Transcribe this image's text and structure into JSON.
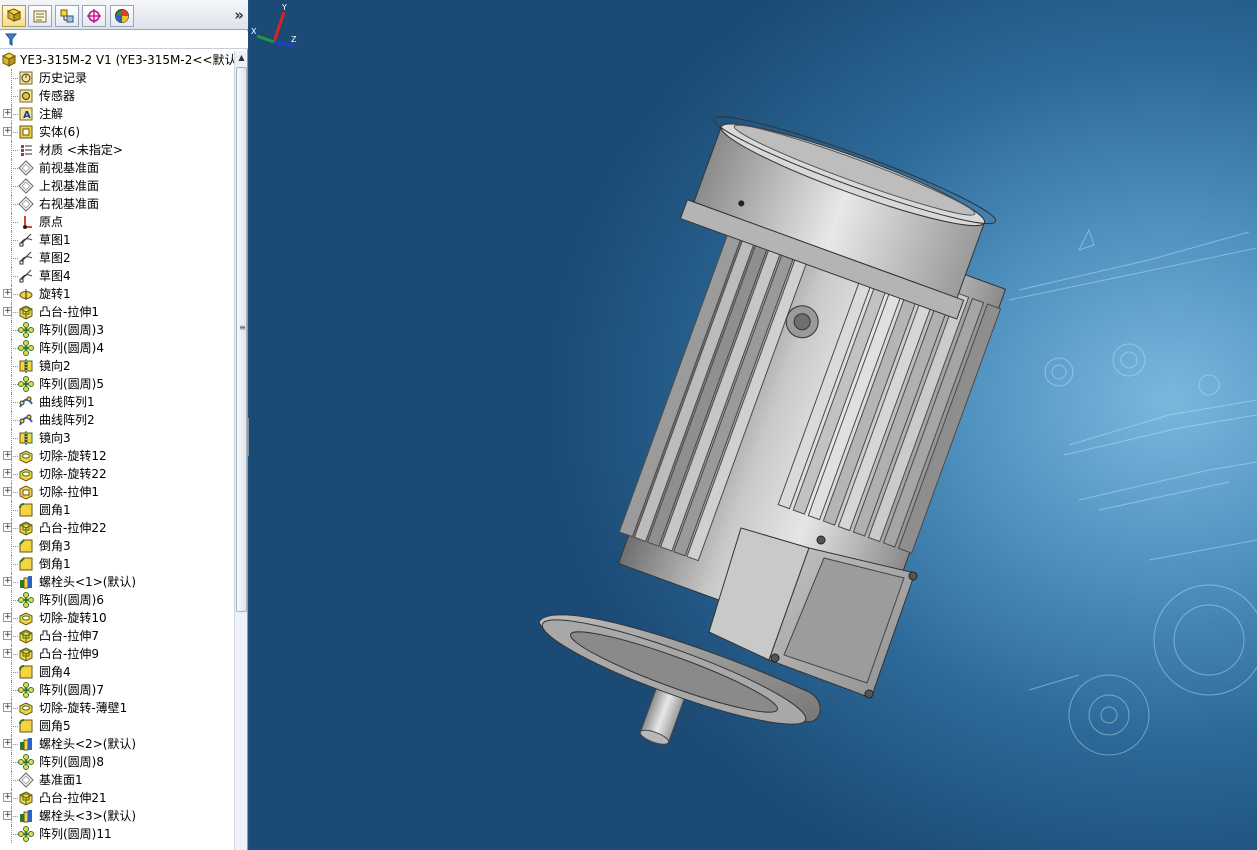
{
  "panel": {
    "tabs": [
      {
        "name": "featuremanager",
        "icon": "feature-tree-icon"
      },
      {
        "name": "propertymanager",
        "icon": "property-manager-icon"
      },
      {
        "name": "configurationmanager",
        "icon": "configuration-manager-icon"
      },
      {
        "name": "dimxpert",
        "icon": "dimxpert-icon"
      },
      {
        "name": "display",
        "icon": "display-manager-icon"
      }
    ],
    "more": "»",
    "scroll_up": "▲",
    "scroll_grip": "≡",
    "collapse": "◂◂◂"
  },
  "tree": {
    "root": "YE3-315M-2 V1  (YE3-315M-2<<默认",
    "items": [
      {
        "label": "历史记录",
        "icon": "history",
        "exp": false
      },
      {
        "label": "传感器",
        "icon": "sensor",
        "exp": false
      },
      {
        "label": "注解",
        "icon": "annotation",
        "exp": true
      },
      {
        "label": "实体(6)",
        "icon": "solid-bodies",
        "exp": true
      },
      {
        "label": "材质 <未指定>",
        "icon": "material",
        "exp": false
      },
      {
        "label": "前视基准面",
        "icon": "plane",
        "exp": false
      },
      {
        "label": "上视基准面",
        "icon": "plane",
        "exp": false
      },
      {
        "label": "右视基准面",
        "icon": "plane",
        "exp": false
      },
      {
        "label": "原点",
        "icon": "origin",
        "exp": false
      },
      {
        "label": "草图1",
        "icon": "sketch",
        "exp": false
      },
      {
        "label": "草图2",
        "icon": "sketch",
        "exp": false
      },
      {
        "label": "草图4",
        "icon": "sketch",
        "exp": false
      },
      {
        "label": "旋转1",
        "icon": "revolve",
        "exp": true
      },
      {
        "label": "凸台-拉伸1",
        "icon": "boss-extrude",
        "exp": true
      },
      {
        "label": "阵列(圆周)3",
        "icon": "circular-pattern",
        "exp": false
      },
      {
        "label": "阵列(圆周)4",
        "icon": "circular-pattern",
        "exp": false
      },
      {
        "label": "镜向2",
        "icon": "mirror",
        "exp": false
      },
      {
        "label": "阵列(圆周)5",
        "icon": "circular-pattern",
        "exp": false
      },
      {
        "label": "曲线阵列1",
        "icon": "curve-pattern",
        "exp": false
      },
      {
        "label": "曲线阵列2",
        "icon": "curve-pattern",
        "exp": false
      },
      {
        "label": "镜向3",
        "icon": "mirror",
        "exp": false
      },
      {
        "label": "切除-旋转12",
        "icon": "cut-revolve",
        "exp": true
      },
      {
        "label": "切除-旋转22",
        "icon": "cut-revolve",
        "exp": true
      },
      {
        "label": "切除-拉伸1",
        "icon": "cut-extrude",
        "exp": true
      },
      {
        "label": "圆角1",
        "icon": "fillet",
        "exp": false
      },
      {
        "label": "凸台-拉伸22",
        "icon": "boss-extrude",
        "exp": true
      },
      {
        "label": "倒角3",
        "icon": "chamfer",
        "exp": false
      },
      {
        "label": "倒角1",
        "icon": "chamfer",
        "exp": false
      },
      {
        "label": "螺栓头<1>(默认)",
        "icon": "library-feature",
        "exp": true
      },
      {
        "label": "阵列(圆周)6",
        "icon": "circular-pattern",
        "exp": false
      },
      {
        "label": "切除-旋转10",
        "icon": "cut-revolve",
        "exp": true
      },
      {
        "label": "凸台-拉伸7",
        "icon": "boss-extrude",
        "exp": true
      },
      {
        "label": "凸台-拉伸9",
        "icon": "boss-extrude",
        "exp": true
      },
      {
        "label": "圆角4",
        "icon": "fillet",
        "exp": false
      },
      {
        "label": "阵列(圆周)7",
        "icon": "circular-pattern",
        "exp": false
      },
      {
        "label": "切除-旋转-薄壁1",
        "icon": "cut-revolve",
        "exp": true
      },
      {
        "label": "圆角5",
        "icon": "fillet",
        "exp": false
      },
      {
        "label": "螺栓头<2>(默认)",
        "icon": "library-feature",
        "exp": true
      },
      {
        "label": "阵列(圆周)8",
        "icon": "circular-pattern",
        "exp": false
      },
      {
        "label": "基准面1",
        "icon": "plane",
        "exp": false
      },
      {
        "label": "凸台-拉伸21",
        "icon": "boss-extrude",
        "exp": true
      },
      {
        "label": "螺栓头<3>(默认)",
        "icon": "library-feature",
        "exp": true
      },
      {
        "label": "阵列(圆周)11",
        "icon": "circular-pattern",
        "exp": false
      }
    ]
  },
  "viewport": {
    "background_accent": "#7ab8dd",
    "model": "motor-model",
    "triad": {
      "x": "X",
      "y": "Y",
      "z": "Z"
    }
  },
  "colors": {
    "panel_bg": "#ffffff",
    "viewport_dark": "#1b4a74",
    "viewport_light": "#7ab8dd",
    "model_gray": "#a9a9a9",
    "icon_yellow": "#f3d443"
  }
}
